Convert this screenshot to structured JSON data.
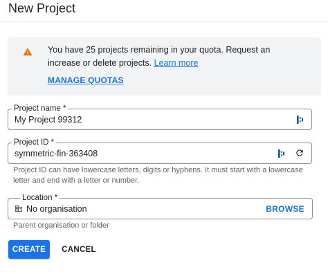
{
  "dialog": {
    "title": "New Project"
  },
  "notice": {
    "text": "You have 25 projects remaining in your quota. Request an increase or delete projects. ",
    "link": "Learn more",
    "manage_label": "MANAGE QUOTAS",
    "icon": "warning-icon",
    "icon_color": "#e37400"
  },
  "fields": {
    "project_name": {
      "label": "Project name *",
      "value": "My Project 99312"
    },
    "project_id": {
      "label": "Project ID *",
      "value": "symmetric-fin-363408",
      "helper": "Project ID can have lowercase letters, digits or hyphens. It must start with a lowercase letter and end with a letter or number."
    },
    "location": {
      "label": "Location *",
      "value": "No organisation",
      "browse_label": "BROWSE",
      "helper": "Parent organisation or folder"
    }
  },
  "actions": {
    "create_label": "CREATE",
    "cancel_label": "CANCEL"
  },
  "colors": {
    "accent": "#1a73e8",
    "notice_bg": "#f1f3f4",
    "border": "#8f8f8f"
  }
}
